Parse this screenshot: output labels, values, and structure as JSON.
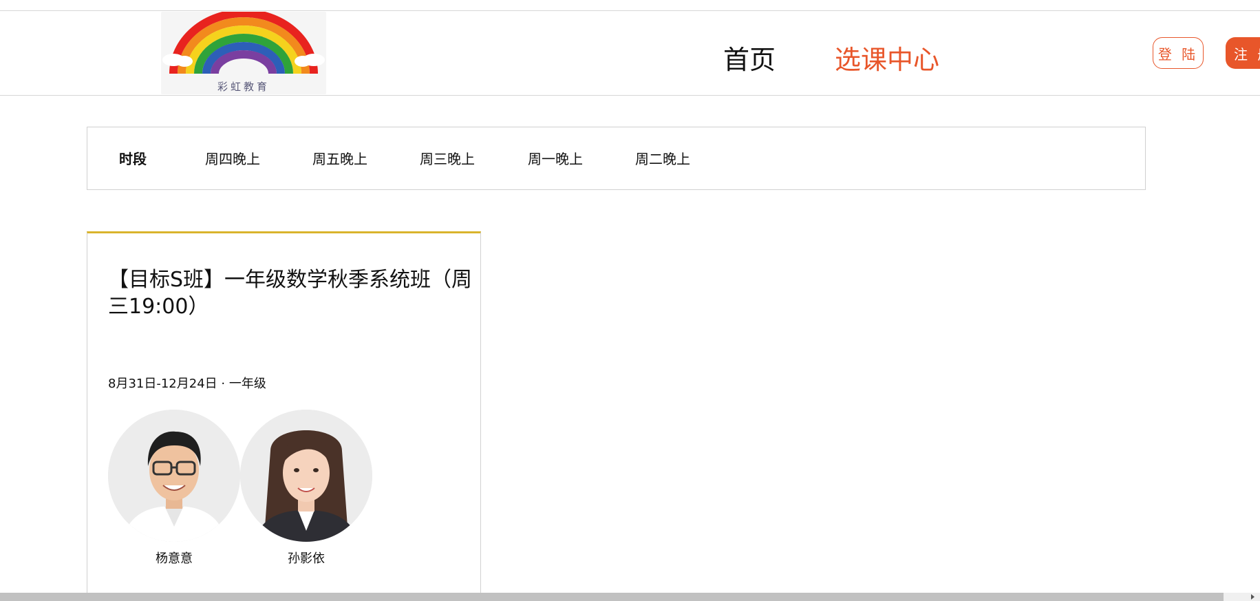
{
  "header": {
    "logo_text": "彩虹教育",
    "nav": {
      "home": "首页",
      "course_center": "选课中心"
    },
    "login_label": "登 陆",
    "register_label": "注 册"
  },
  "colors": {
    "accent": "#e8562a",
    "card_top_border": "#d9b42c"
  },
  "filter": {
    "label": "时段",
    "options": [
      "周四晚上",
      "周五晚上",
      "周三晚上",
      "周一晚上",
      "周二晚上"
    ]
  },
  "course_card": {
    "title": "【目标S班】一年级数学秋季系统班（周三19:00）",
    "meta": "8月31日-12月24日 · 一年级",
    "teachers": [
      {
        "name": "杨意意",
        "avatar": "male-teacher-avatar"
      },
      {
        "name": "孙影依",
        "avatar": "female-teacher-avatar"
      }
    ]
  }
}
